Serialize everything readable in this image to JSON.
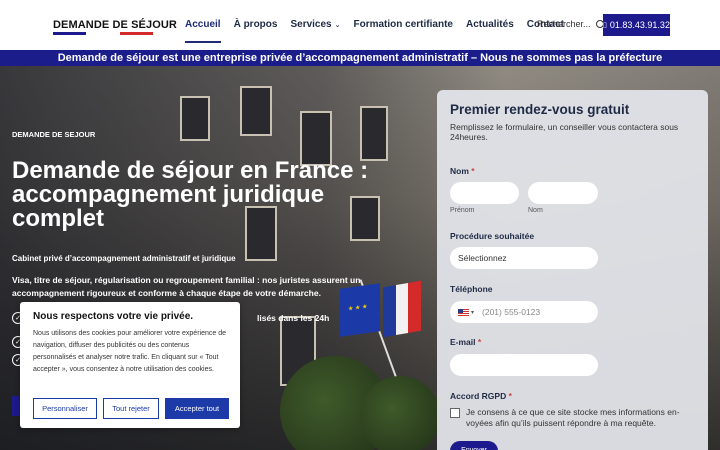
{
  "header": {
    "logo": "DEMANDE DE SÉJOUR",
    "logo_colors": [
      "#1c1a8c",
      "#ffffff",
      "#d42a2a"
    ],
    "nav": [
      {
        "label": "Accueil"
      },
      {
        "label": "À propos"
      },
      {
        "label": "Services"
      },
      {
        "label": "Formation certifiante"
      },
      {
        "label": "Actualités"
      },
      {
        "label": "Contact"
      }
    ],
    "search_placeholder": "Rechercher...",
    "phone": "01.83.43.91.32"
  },
  "banner": "Demande de séjour est une entreprise privée d’accompagnement administratif – Nous ne sommes pas la préfecture",
  "hero": {
    "eyebrow": "DEMANDE DE SEJOUR",
    "title": "Demande de séjour en France : accompagnement juridique complet",
    "subtitle": "Cabinet privé d’accompagnement administratif et juridique",
    "description": "Visa, titre de séjour, régularisation ou regroupement familial : nos juristes assurent un accompagnement rigoureux et conforme à chaque étape de votre démarche.",
    "bullet_1": "lisés dans les 24h"
  },
  "form": {
    "title": "Premier rendez-vous gratuit",
    "intro": "Remplissez le formulaire, un conseiller vous contactera sous 24heures.",
    "nom_label": "Nom",
    "prenom_sub": "Prénom",
    "nom_sub": "Nom",
    "procedure_label": "Procédure souhaitée",
    "procedure_value": "Sélectionnez",
    "phone_label": "Téléphone",
    "phone_placeholder": "(201) 555-0123",
    "email_label": "E-mail",
    "rgpd_label": "Accord RGPD",
    "consent_text": "Je consens à ce que ce site stocke mes informations en-voyées afin qu’ils puissent répondre à ma requête.",
    "submit_label": "Envoyer",
    "required_mark": "*"
  },
  "cookie": {
    "title": "Nous respectons votre vie privée.",
    "text": "Nous utilisons des cookies pour améliorer votre expérience de navigation, diffuser des publicités ou des contenus personnalisés et analyser notre trafic. En cliquant sur « Tout accepter », vous consentez à notre utilisation des cookies.",
    "btn_customize": "Personnaliser",
    "btn_reject": "Tout rejeter",
    "btn_accept": "Accepter tout"
  }
}
